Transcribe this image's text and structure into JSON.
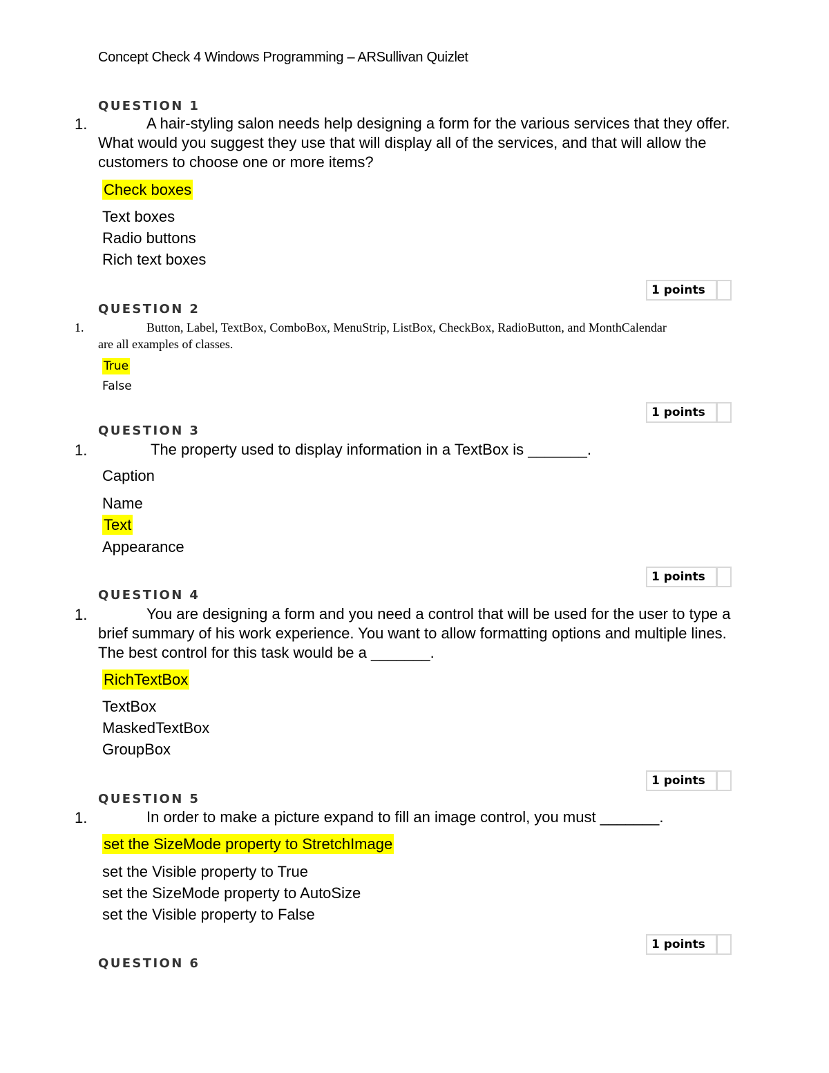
{
  "document": {
    "title": "Concept Check 4 Windows Programming – ARSullivan Quizlet"
  },
  "points_label": "1 points",
  "questions": [
    {
      "header": "QUESTION 1",
      "number": "1.",
      "text": "A hair-styling salon needs help designing a form for the various services that they offer. What would you suggest they use that will display all of the services, and that will allow the customers to choose one or more items?",
      "options": [
        "Check boxes",
        "Text boxes",
        "Radio buttons",
        "Rich text boxes"
      ],
      "highlighted_answer": "Check boxes"
    },
    {
      "header": "QUESTION 2",
      "number": "1.",
      "text": "Button, Label, TextBox, ComboBox, MenuStrip, ListBox, CheckBox, RadioButton, and MonthCalendar are all examples of classes.",
      "options": [
        "True",
        "False"
      ],
      "highlighted_answer": "True"
    },
    {
      "header": "QUESTION 3",
      "number": "1.",
      "text": "The property used to display information in a TextBox is _______.",
      "options": [
        "Caption",
        "Name",
        "Text",
        "Appearance"
      ],
      "highlighted_answer": "Text"
    },
    {
      "header": "QUESTION 4",
      "number": "1.",
      "text": "You are designing a form and you need a control that will be used for the user to type a brief summary of his work experience. You want to allow formatting options and multiple lines. The best control for this task would be a _______.",
      "options": [
        "RichTextBox",
        "TextBox",
        "MaskedTextBox",
        "GroupBox"
      ],
      "highlighted_answer": "RichTextBox"
    },
    {
      "header": "QUESTION 5",
      "number": "1.",
      "text": "In order to make a picture expand to fill an image control, you must _______.",
      "options": [
        "set the SizeMode property to StretchImage",
        "set the Visible property to True",
        "set the SizeMode property to AutoSize",
        "set the Visible property to False"
      ],
      "highlighted_answer": "set the SizeMode property to StretchImage"
    },
    {
      "header": "QUESTION 6"
    }
  ],
  "colors": {
    "highlight": "#ffff00",
    "points_border": "#d8d8d8"
  }
}
